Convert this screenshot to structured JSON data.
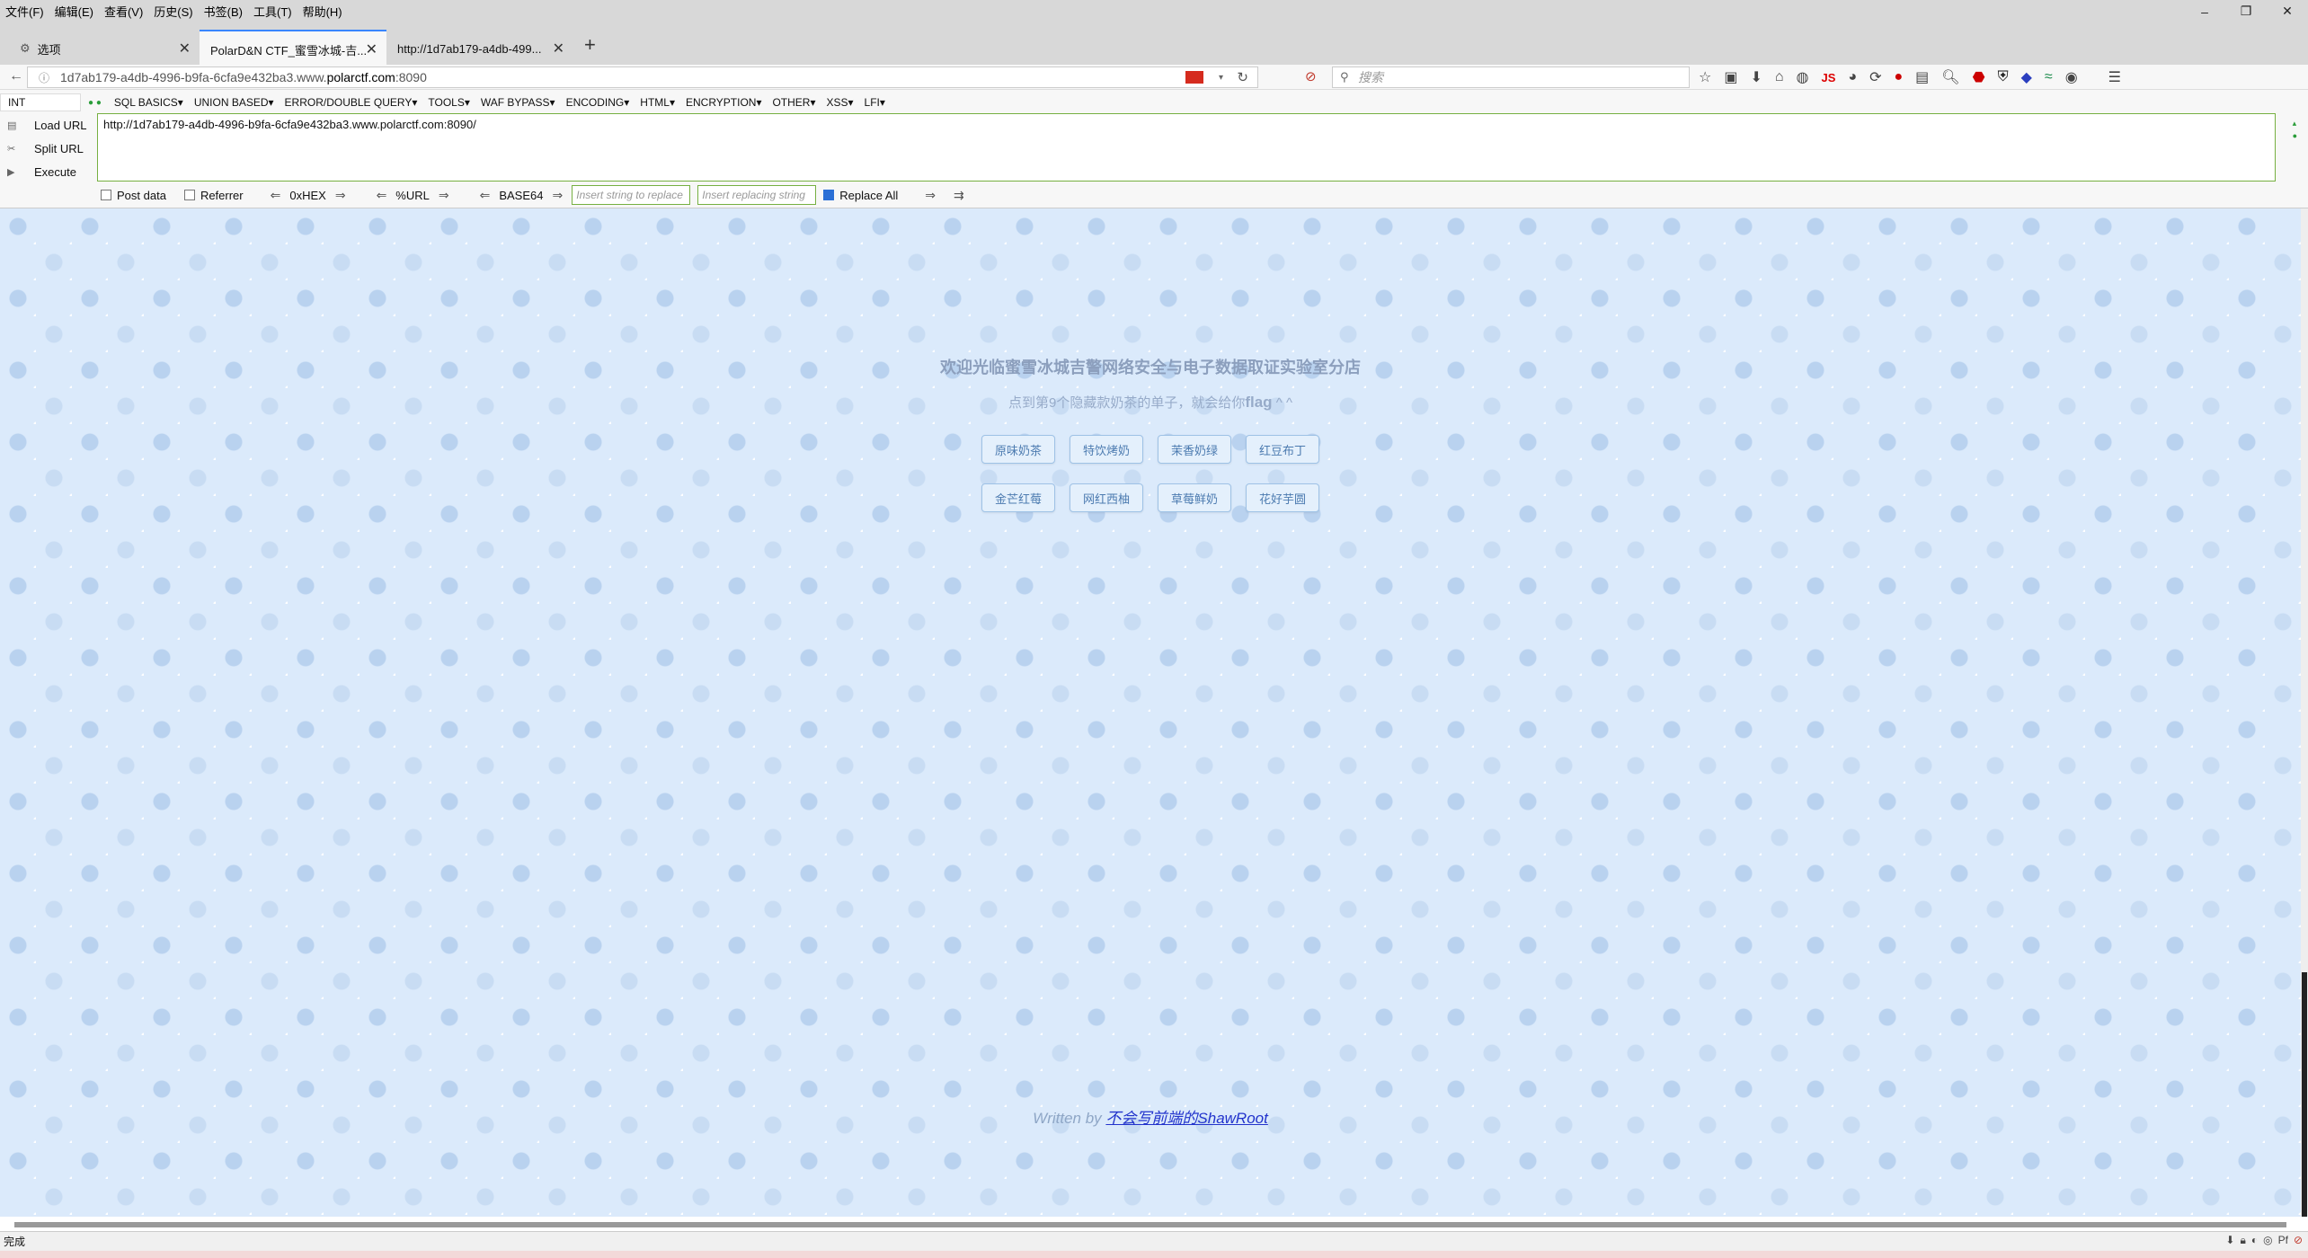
{
  "menubar": {
    "items": [
      "文件(F)",
      "编辑(E)",
      "查看(V)",
      "历史(S)",
      "书签(B)",
      "工具(T)",
      "帮助(H)"
    ]
  },
  "tabs": [
    {
      "label": "选项"
    },
    {
      "label": "PolarD&N CTF_蜜雪冰城-吉..."
    },
    {
      "label": "http://1d7ab179-a4db-499..."
    }
  ],
  "navbar": {
    "url_prefix": "1d7ab179-a4db-4996-b9fa-6cfa9e432ba3.www.",
    "url_host": "polarctf.com",
    "url_suffix": ":8090",
    "search_placeholder": "搜索"
  },
  "hackbar": {
    "select_value": "INT",
    "menus": [
      "SQL BASICS▾",
      "UNION BASED▾",
      "ERROR/DOUBLE QUERY▾",
      "TOOLS▾",
      "WAF BYPASS▾",
      "ENCODING▾",
      "HTML▾",
      "ENCRYPTION▾",
      "OTHER▾",
      "XSS▾",
      "LFI▾"
    ],
    "load_url": "Load URL",
    "split_url": "Split URL",
    "execute": "Execute",
    "url_value": "http://1d7ab179-a4db-4996-b9fa-6cfa9e432ba3.www.polarctf.com:8090/",
    "post_data": "Post data",
    "referrer": "Referrer",
    "hex": "0xHEX",
    "urlenc": "%URL",
    "base64": "BASE64",
    "replace_placeholder": "Insert string to replace",
    "replacing_placeholder": "Insert replacing string",
    "replace_all": "Replace All"
  },
  "page": {
    "welcome": "欢迎光临蜜雪冰城吉警网络安全与电子数据取证实验室分店",
    "hint_prefix": "点到第9个隐藏款奶茶的单子，就会给你",
    "hint_flag": "flag",
    "hint_suffix": " ^ ^",
    "buttons": [
      "原味奶茶",
      "特饮烤奶",
      "茉香奶绿",
      "红豆布丁",
      "金芒红莓",
      "网红西柚",
      "草莓鲜奶",
      "花好芋圆"
    ],
    "footer_prefix": "Written by ",
    "footer_link": "不会写前端的ShawRoot"
  },
  "status": {
    "text": "完成"
  }
}
